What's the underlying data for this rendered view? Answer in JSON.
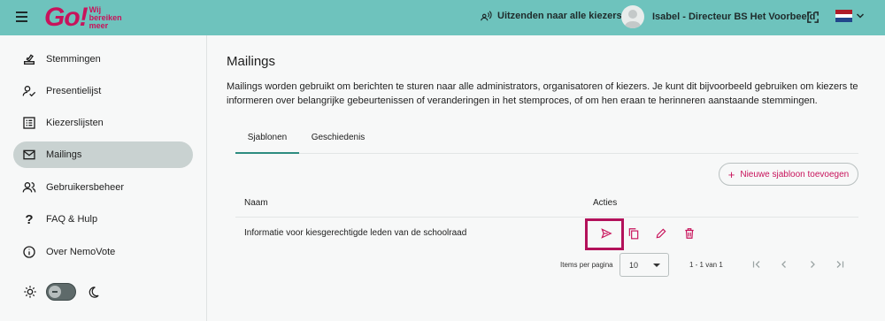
{
  "logo": {
    "mark": "Go!",
    "tagline_1": "Wij",
    "tagline_2": "bereiken",
    "tagline_3": "meer"
  },
  "topbar": {
    "broadcast_label": "Uitzenden naar alle kiezers",
    "user_name": "Isabel - Directeur BS Het Voorbeeld",
    "language_flag": "dutch-flag-icon"
  },
  "sidebar": {
    "items": [
      {
        "label": "Stemmingen",
        "icon": "ballot-icon"
      },
      {
        "label": "Presentielijst",
        "icon": "attendance-icon"
      },
      {
        "label": "Kiezerslijsten",
        "icon": "list-icon"
      },
      {
        "label": "Mailings",
        "icon": "mail-icon",
        "active": true
      },
      {
        "label": "Gebruikersbeheer",
        "icon": "users-icon"
      },
      {
        "label": "FAQ & Hulp",
        "icon": "question-icon"
      },
      {
        "label": "Over NemoVote",
        "icon": "info-icon"
      }
    ],
    "theme": {
      "light_icon": "sun-icon",
      "dark_icon": "moon-icon"
    }
  },
  "main": {
    "title": "Mailings",
    "intro": "Mailings worden gebruikt om berichten te sturen naar alle administrators, organisatoren of kiezers. Je kunt dit bijvoorbeeld gebruiken om kiezers te informeren over belangrijke gebeurtenissen of veranderingen in het stemproces, of om hen eraan te herinneren aanstaande stemmingen.",
    "tabs": [
      {
        "label": "Sjablonen",
        "active": true
      },
      {
        "label": "Geschiedenis"
      }
    ],
    "add_button": "Nieuwe sjabloon toevoegen",
    "table": {
      "headers": {
        "name": "Naam",
        "actions": "Acties"
      },
      "rows": [
        {
          "name": "Informatie voor kiesgerechtigde leden van de schoolraad"
        }
      ]
    },
    "paginator": {
      "items_per_page_label": "Items per pagina",
      "page_size": "10",
      "range": "1 - 1 van 1"
    }
  },
  "colors": {
    "topbar": "#6ec3bd",
    "brand": "#c8135b",
    "active_nav": "#c9d2d1",
    "tab_underline": "#2e8c80",
    "highlight": "#b3115a"
  }
}
